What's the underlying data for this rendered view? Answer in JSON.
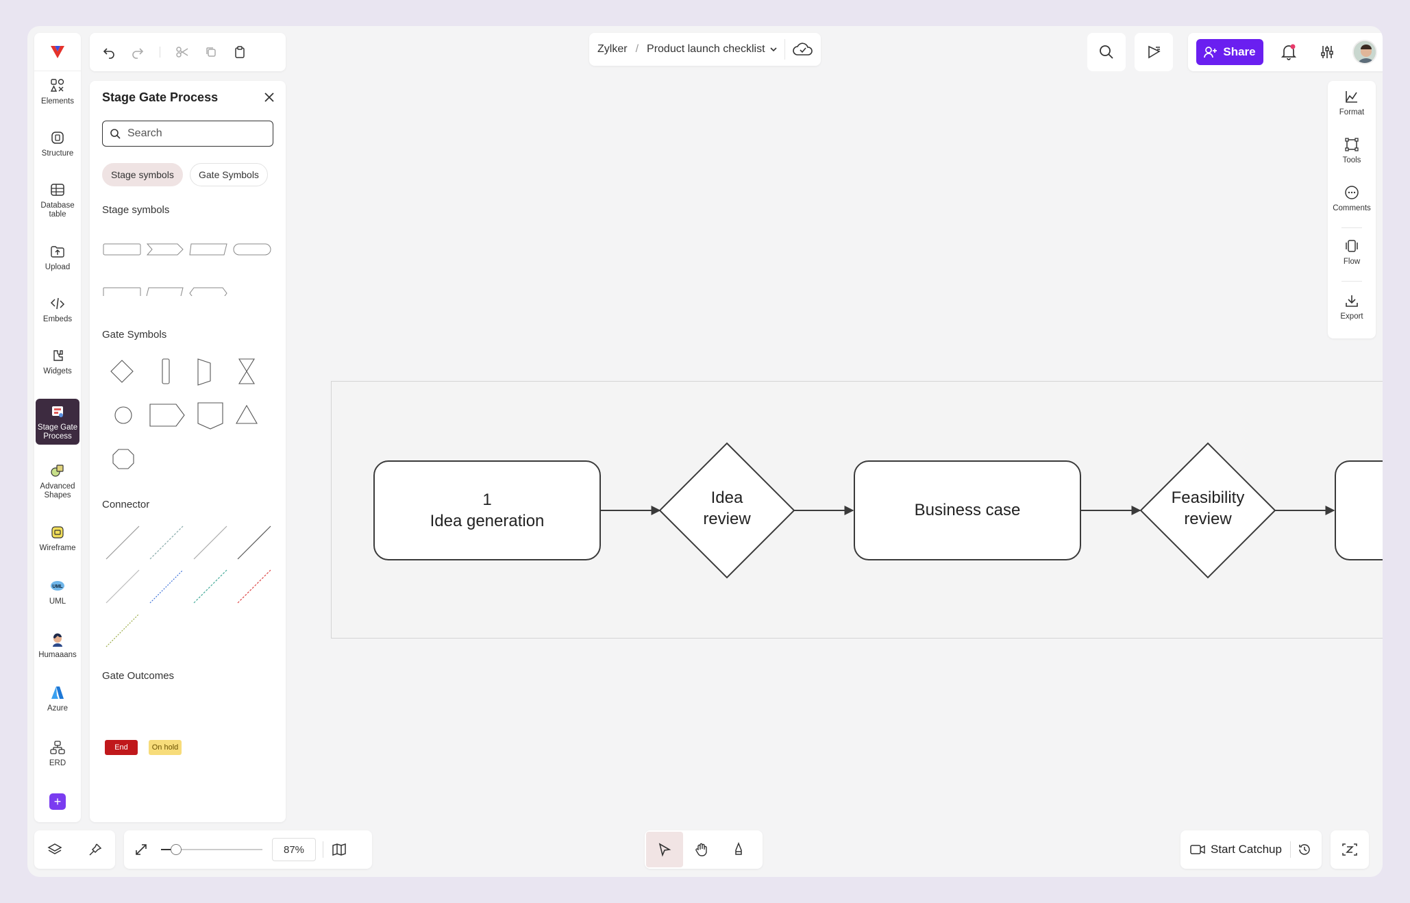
{
  "left_rail": {
    "items": [
      {
        "label": "Elements",
        "icon": "shapes-icon"
      },
      {
        "label": "Structure",
        "icon": "structure-icon"
      },
      {
        "label": "Database table",
        "icon": "database-table-icon"
      },
      {
        "label": "Upload",
        "icon": "upload-icon"
      },
      {
        "label": "Embeds",
        "icon": "embed-icon"
      },
      {
        "label": "Widgets",
        "icon": "widgets-icon"
      },
      {
        "label": "Stage Gate Process",
        "icon": "stage-gate-icon",
        "active": true
      },
      {
        "label": "Advanced Shapes",
        "icon": "advanced-shapes-icon"
      },
      {
        "label": "Wireframe",
        "icon": "wireframe-icon"
      },
      {
        "label": "UML",
        "icon": "uml-icon"
      },
      {
        "label": "Humaaans",
        "icon": "humaaans-icon"
      },
      {
        "label": "Azure",
        "icon": "azure-icon"
      },
      {
        "label": "ERD",
        "icon": "erd-icon"
      }
    ],
    "add_label": "+"
  },
  "breadcrumb": {
    "workspace": "Zylker",
    "separator": "/",
    "document": "Product launch checklist"
  },
  "share": {
    "label": "Share"
  },
  "panel": {
    "title": "Stage Gate Process",
    "search_placeholder": "Search",
    "chips": [
      "Stage symbols",
      "Gate Symbols"
    ],
    "sections": {
      "stage": "Stage symbols",
      "gate": "Gate Symbols",
      "connector": "Connector",
      "outcomes": "Gate Outcomes"
    },
    "outcomes": [
      {
        "label": "End",
        "bg": "#c0181b",
        "fg": "#ffffff"
      },
      {
        "label": "On hold",
        "bg": "#f7dc7a",
        "fg": "#6b5200"
      }
    ]
  },
  "right_panel": {
    "items": [
      "Format",
      "Tools",
      "Comments",
      "Flow",
      "Export"
    ]
  },
  "canvas": {
    "stages": [
      {
        "line1": "1",
        "line2": "Idea generation"
      },
      {
        "line1": "Business case",
        "line2": ""
      }
    ],
    "gates": [
      {
        "line1": "Idea",
        "line2": "review"
      },
      {
        "line1": "Feasibility",
        "line2": "review"
      }
    ]
  },
  "bottom": {
    "zoom": "87%",
    "catchup": "Start Catchup"
  },
  "colors": {
    "accent": "#6a1ff0",
    "active_rail": "#3d2b40",
    "active_chip": "#efe3e3"
  }
}
